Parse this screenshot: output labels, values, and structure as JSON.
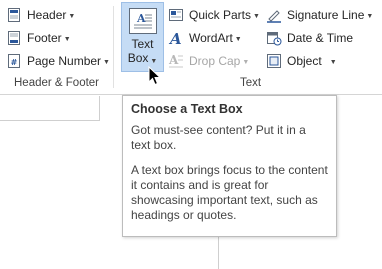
{
  "ribbon": {
    "header_footer": {
      "group_label": "Header & Footer",
      "header_label": "Header",
      "footer_label": "Footer",
      "page_number_label": "Page Number",
      "icons": [
        "header-icon",
        "footer-icon",
        "page-number-icon"
      ]
    },
    "text": {
      "group_label": "Text",
      "text_box_label_line1": "Text",
      "text_box_label_line2": "Box",
      "quick_parts_label": "Quick Parts",
      "wordart_label": "WordArt",
      "drop_cap_label": "Drop Cap",
      "signature_line_label": "Signature Line",
      "date_time_label": "Date & Time",
      "object_label": "Object",
      "icons": [
        "text-box-icon",
        "quick-parts-icon",
        "wordart-icon",
        "drop-cap-icon",
        "signature-line-icon",
        "date-time-icon",
        "object-icon"
      ]
    }
  },
  "tooltip": {
    "title": "Choose a Text Box",
    "line1": "Got must-see content? Put it in a text box.",
    "line2": "A text box brings focus to the content it contains and is great for showcasing important text, such as headings or quotes."
  },
  "colors": {
    "active_button_bg": "#c5dcf5",
    "active_button_border": "#9ebfe6",
    "accent_blue": "#2b579a",
    "disabled_text": "#a6a6a6"
  }
}
